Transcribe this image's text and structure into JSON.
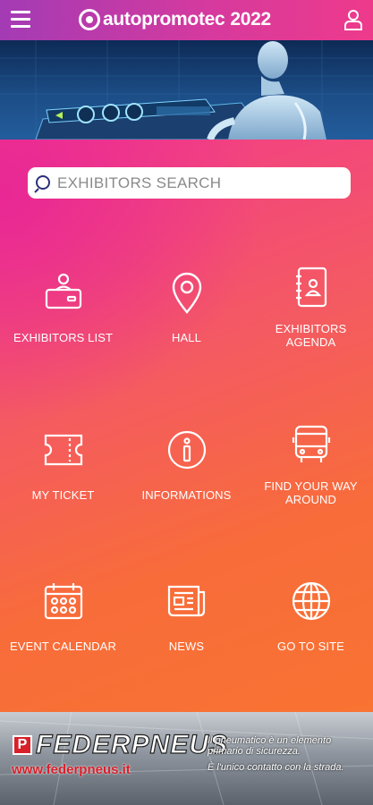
{
  "app": {
    "brand": "autopromotec",
    "year": "2022"
  },
  "search": {
    "placeholder": "EXHIBITORS SEARCH"
  },
  "tiles": [
    {
      "label": "EXHIBITORS LIST",
      "icon": "exhibitor-desk-icon"
    },
    {
      "label": "HALL",
      "icon": "map-pin-icon"
    },
    {
      "label": "EXHIBITORS AGENDA",
      "icon": "contact-book-icon"
    },
    {
      "label": "MY TICKET",
      "icon": "ticket-icon"
    },
    {
      "label": "INFORMATIONS",
      "icon": "info-icon"
    },
    {
      "label": "FIND YOUR WAY AROUND",
      "icon": "bus-icon"
    },
    {
      "label": "EVENT CALENDAR",
      "icon": "calendar-icon"
    },
    {
      "label": "NEWS",
      "icon": "newspaper-icon"
    },
    {
      "label": "GO TO SITE",
      "icon": "globe-icon"
    }
  ],
  "ad": {
    "brand": "FEDERPNEUS",
    "badge": "P",
    "url": "www.federpneus.it",
    "tagline1": "Il pneumatico è un elemento primario di sicurezza.",
    "tagline2": "È l'unico contatto con la strada."
  },
  "colors": {
    "header_left": "#a33bb5",
    "header_right": "#ee3a8b",
    "main_top": "#f23a8c",
    "main_bottom": "#f97332",
    "ad_accent": "#d8202a"
  }
}
